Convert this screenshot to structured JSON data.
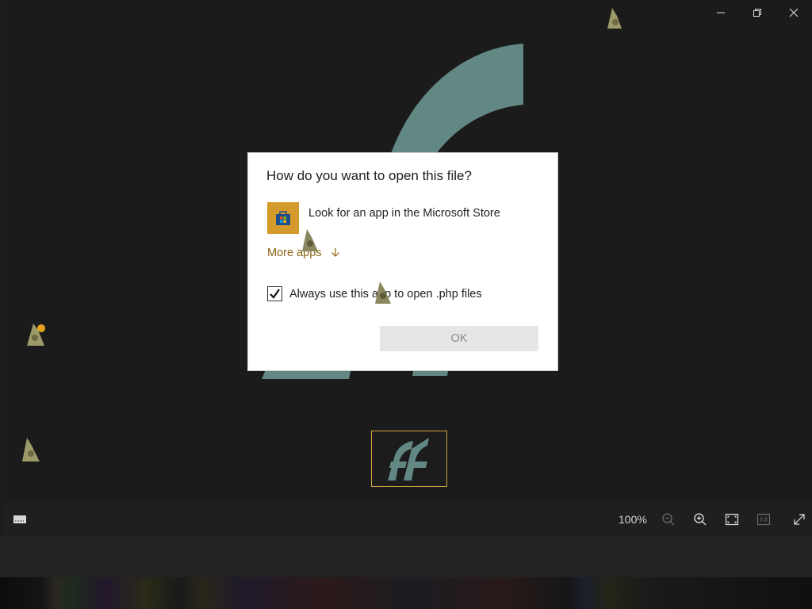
{
  "window": {
    "minimize_icon": "minimize-icon",
    "restore_icon": "restore-icon",
    "close_icon": "close-icon"
  },
  "dialog": {
    "title": "How do you want to open this file?",
    "store_option": {
      "label": "Look for an app in the Microsoft Store",
      "icon": "microsoft-store-icon"
    },
    "more_apps_label": "More apps",
    "more_apps_icon": "arrow-down-icon",
    "always_use": {
      "label": "Always use this app to open .php files",
      "checked": true
    },
    "ok_label": "OK"
  },
  "toolbar": {
    "zoom_level": "100%",
    "icons": [
      "filmstrip-icon",
      "zoom-out-icon",
      "zoom-in-icon",
      "fit-to-window-icon",
      "actual-size-icon",
      "fullscreen-icon"
    ]
  },
  "colors": {
    "background": "#1b1b1b",
    "logo_teal": "#628883",
    "accent_gold": "#d49b2c",
    "link_gold": "#8a6410"
  }
}
